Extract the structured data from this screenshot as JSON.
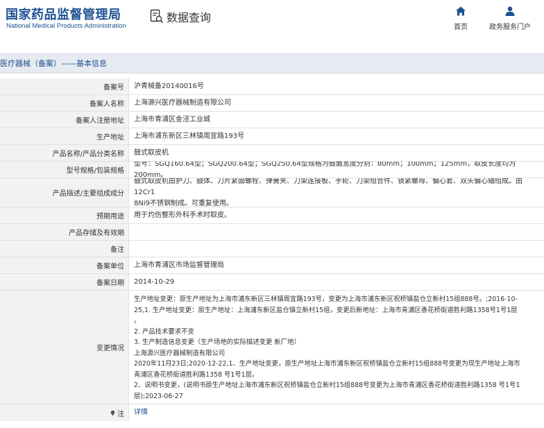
{
  "header": {
    "logo_cn": "国家药品监督管理局",
    "logo_en": "National Medical Products Administration",
    "query_label": "数据查询",
    "query_icon": "search-document-icon",
    "nav": [
      {
        "label": "首页",
        "icon": "home-icon"
      },
      {
        "label": "政务服务门户",
        "icon": "user-icon"
      }
    ]
  },
  "breadcrumb": "医疗器械（备案）——基本信息",
  "colors": {
    "brand": "#1d4f91",
    "label_bg": "#f2f2f2",
    "bar_bg": "#e6ebf1",
    "border": "#e1e1e1"
  },
  "rows": [
    {
      "label": "备案号",
      "value": "沪青械备20140016号"
    },
    {
      "label": "备案人名称",
      "value": "上海源兴医疗器械制造有限公司"
    },
    {
      "label": "备案人注册地址",
      "value": "上海市青浦区金泾工业城"
    },
    {
      "label": "生产地址",
      "value": "上海市浦东新区三林镇周宜路193号"
    },
    {
      "label": "产品名称/产品分类名称",
      "value": "鼓式取皮机"
    },
    {
      "label": "型号规格/包装规格",
      "value": "型号：SGQ160.64型；SGQ200.64型；SGQ250.64型规格为鼓面宽度分别：80mm；100mm；125mm，取皮长度均为200mm。"
    },
    {
      "label": "产品描述/主要组成成分",
      "value": "鼓式取皮机由护刀、鼓体、刀片紧固螺栓、弹簧夹、刀架连接板、手轮、刀架组合件、锁紧螺母、偏心套、双头偏心轴组成。由12Cr1\n8Ni9不锈钢制成。可重复使用。"
    },
    {
      "label": "预期用途",
      "value": "用于灼伤整形外科手术时取皮。"
    },
    {
      "label": "产品存储及有效期",
      "value": ""
    },
    {
      "label": "备注",
      "value": ""
    },
    {
      "label": "备案单位",
      "value": "上海市青浦区市场监督管理局"
    },
    {
      "label": "备案日期",
      "value": "2014-10-29"
    },
    {
      "label": "变更情况",
      "value": "生产地址变更：原生产地址为上海市浦东新区三林镇周宜路193号，变更为上海市浦东新区祝桥镇盐仓立新村15组888号。;2016-10-\n25,1. 生产地址变更：原生产地址：上海浦东新区盐仓镇立新村15组，变更后新地址：上海市青浦区香花桥街道胜利路1358号1号1层\n。\n2. 产品技术要求不变\n3. 生产制造信息变更（生产场地的实际描述变更 新厂地）\n上海源兴医疗器械制造有限公司\n2020年11月23日;2020-12-22,1、生产地址变更，原生产地址上海市浦东新区祝桥镇盐仓立新村15组888号变更为现生产地址上海市\n青浦区香花桥街道胜利路1358 号1号1层。\n2、说明书变更，(说明书原生产地址上海市浦东新区祝桥镇盐仓立新村15组888号变更为上海市青浦区香花桥街道胜利路1358 号1号1\n层);2023-06-27"
    },
    {
      "label": "注",
      "value": "详情",
      "label_icon": "pin-icon"
    }
  ]
}
